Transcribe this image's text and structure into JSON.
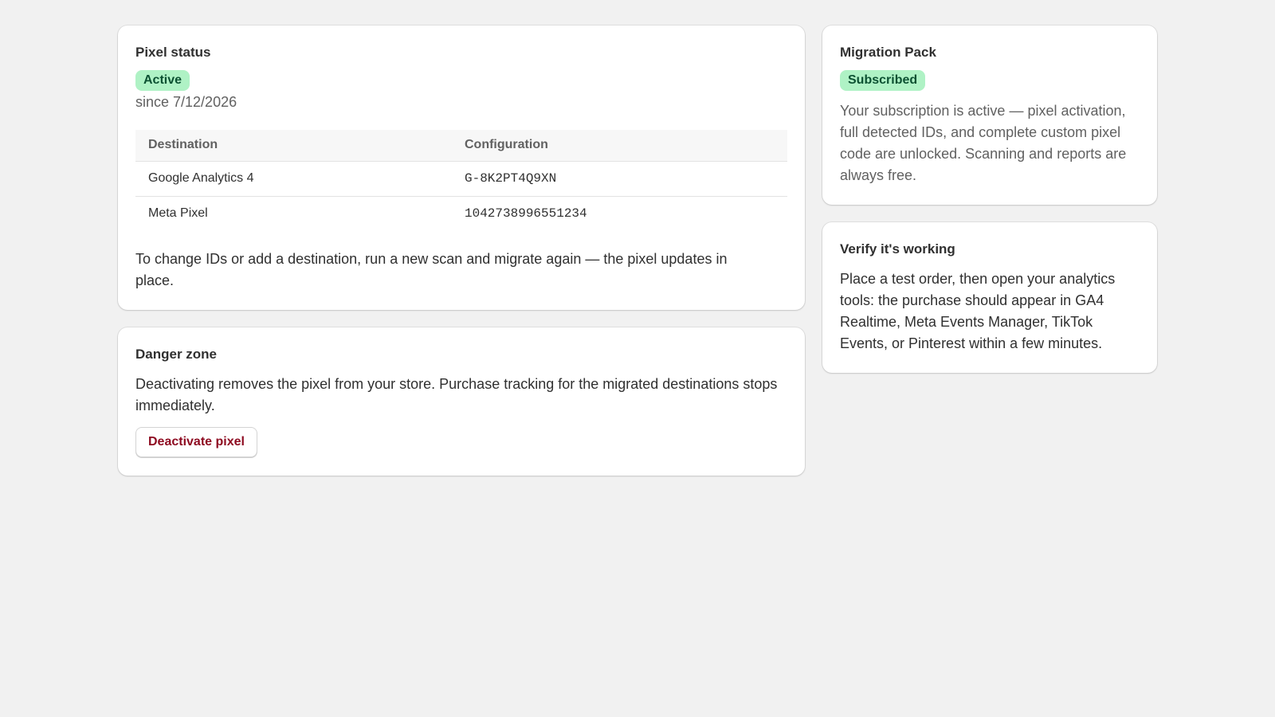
{
  "pixel_status": {
    "title": "Pixel status",
    "status_badge": "Active",
    "since": "since 7/12/2026",
    "table": {
      "headers": [
        "Destination",
        "Configuration"
      ],
      "rows": [
        {
          "destination": "Google Analytics 4",
          "configuration": "G-8K2PT4Q9XN"
        },
        {
          "destination": "Meta Pixel",
          "configuration": "1042738996551234"
        }
      ]
    },
    "note": "To change IDs or add a destination, run a new scan and migrate again — the pixel updates in place."
  },
  "danger_zone": {
    "title": "Danger zone",
    "description": "Deactivating removes the pixel from your store. Purchase tracking for the migrated destinations stops immediately.",
    "button_label": "Deactivate pixel"
  },
  "migration_pack": {
    "title": "Migration Pack",
    "status_badge": "Subscribed",
    "description": "Your subscription is active — pixel activation, full detected IDs, and complete custom pixel code are unlocked. Scanning and reports are always free."
  },
  "verify": {
    "title": "Verify it's working",
    "description": "Place a test order, then open your analytics tools: the purchase should appear in GA4 Realtime, Meta Events Manager, TikTok Events, or Pinterest within a few minutes."
  },
  "colors": {
    "page_background": "#f1f1f1",
    "success_badge_bg": "#aff2c5",
    "success_badge_text": "#0c5132",
    "critical_text": "#8e0b21"
  }
}
